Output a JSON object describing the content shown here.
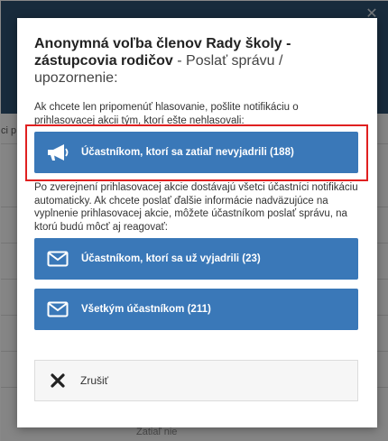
{
  "background": {
    "tab_fragment": "ci p",
    "footer_fragment": "Zatiaľ nie"
  },
  "modal": {
    "title_bold": "Anonymná voľba členov Rady školy - zástupcovia rodičov",
    "title_rest": " - Poslať správu / upozornenie:",
    "desc_reminder": "Ak chcete len pripomenúť hlasovanie, pošlite notifikáciu o prihlasovacej akcii tým, ktorí ešte nehlasovali:",
    "btn_not_responded": "Účastníkom, ktorí sa zatiaľ nevyjadrili (188)",
    "desc_after_publish": "Po zverejnení prihlasovacej akcie dostávajú všetci účastníci notifikáciu automaticky. Ak chcete poslať ďalšie informácie nadväzujúce na vyplnenie prihlasovacej akcie, môžete účastníkom poslať správu, na ktorú budú môcť aj reagovať:",
    "btn_responded": "Účastníkom, ktorí sa už vyjadrili (23)",
    "btn_all": "Všetkým účastníkom (211)",
    "btn_cancel": "Zrušiť"
  },
  "colors": {
    "primary_button": "#3a78b8",
    "highlight_border": "#e02020",
    "header": "#2c4f6e"
  },
  "icons": {
    "btn_not_responded": "megaphone-icon",
    "btn_responded": "envelope-icon",
    "btn_all": "envelope-icon",
    "btn_cancel": "close-icon"
  }
}
